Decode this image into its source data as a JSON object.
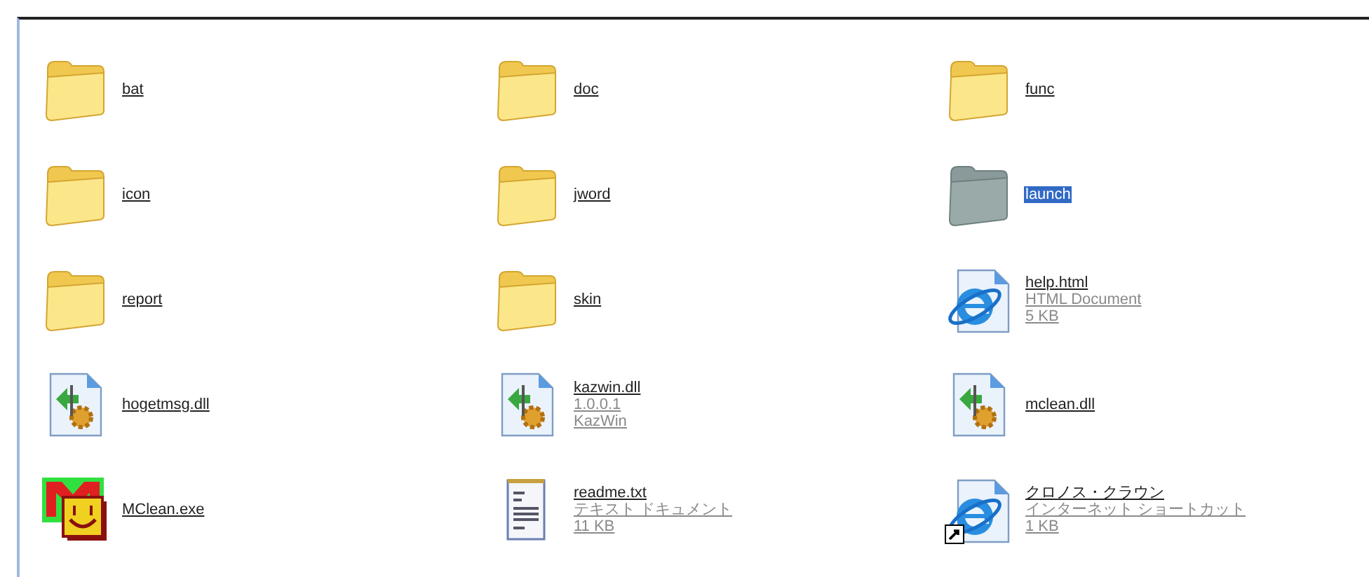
{
  "items": [
    {
      "kind": "folder",
      "name": "bat",
      "selected": false
    },
    {
      "kind": "folder",
      "name": "doc",
      "selected": false
    },
    {
      "kind": "folder",
      "name": "func",
      "selected": false
    },
    {
      "kind": "folder",
      "name": "icon",
      "selected": false
    },
    {
      "kind": "folder",
      "name": "jword",
      "selected": false
    },
    {
      "kind": "folder",
      "name": "launch",
      "selected": true
    },
    {
      "kind": "folder",
      "name": "report",
      "selected": false
    },
    {
      "kind": "folder",
      "name": "skin",
      "selected": false
    },
    {
      "kind": "web",
      "name": "help.html",
      "details": [
        "HTML Document",
        "5 KB"
      ],
      "selected": false,
      "shortcut": false
    },
    {
      "kind": "library",
      "name": "hogetmsg.dll",
      "selected": false
    },
    {
      "kind": "library",
      "name": "kazwin.dll",
      "details": [
        "1.0.0.1",
        "KazWin"
      ],
      "selected": false
    },
    {
      "kind": "library",
      "name": "mclean.dll",
      "selected": false
    },
    {
      "kind": "app",
      "name": "MClean.exe",
      "selected": false
    },
    {
      "kind": "text",
      "name": "readme.txt",
      "details": [
        "テキスト ドキュメント",
        "11 KB"
      ],
      "selected": false
    },
    {
      "kind": "web",
      "name": "クロノス・クラウン",
      "details": [
        "インターネット ショートカット",
        "1 KB"
      ],
      "selected": false,
      "shortcut": true
    }
  ]
}
